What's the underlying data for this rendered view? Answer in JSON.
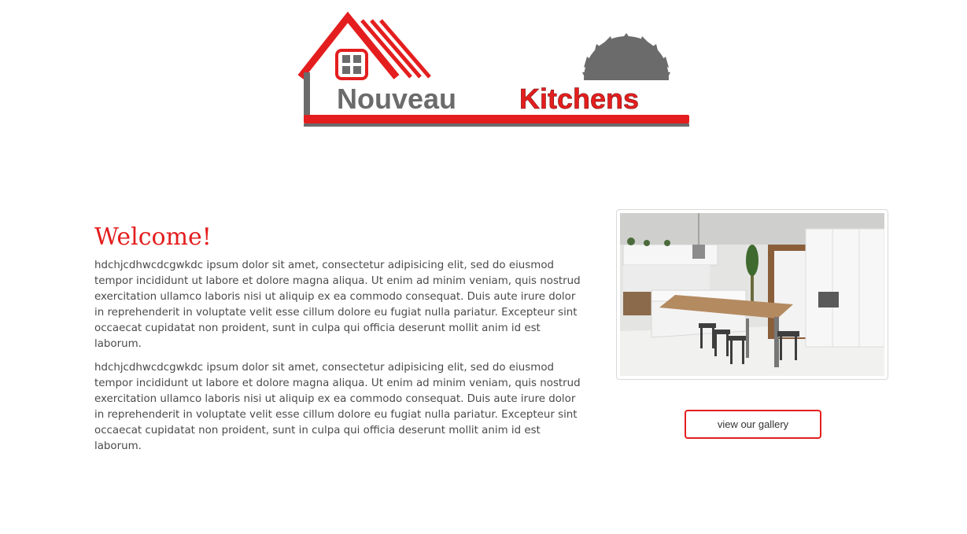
{
  "brand": {
    "logo_word1": "Nouveau",
    "logo_word2": "Kitchens",
    "red": "#e41e1e",
    "grey": "#6b6b6b"
  },
  "welcome": {
    "heading": "Welcome!",
    "paragraphs": [
      "hdchjcdhwcdcgwkdc ipsum dolor sit amet, consectetur adipisicing elit, sed do eiusmod tempor incididunt ut labore et dolore magna aliqua. Ut enim ad minim veniam, quis nostrud exercitation ullamco laboris nisi ut aliquip ex ea commodo consequat. Duis aute irure dolor in reprehenderit in voluptate velit esse cillum dolore eu fugiat nulla pariatur. Excepteur sint occaecat cupidatat non proident, sunt in culpa qui officia deserunt mollit anim id est laborum.",
      "hdchjcdhwcdcgwkdc ipsum dolor sit amet, consectetur adipisicing elit, sed do eiusmod tempor incididunt ut labore et dolore magna aliqua. Ut enim ad minim veniam, quis nostrud exercitation ullamco laboris nisi ut aliquip ex ea commodo consequat. Duis aute irure dolor in reprehenderit in voluptate velit esse cillum dolore eu fugiat nulla pariatur. Excepteur sint occaecat cupidatat non proident, sunt in culpa qui officia deserunt mollit anim id est laborum."
    ]
  },
  "gallery": {
    "button_label": "view our gallery"
  }
}
